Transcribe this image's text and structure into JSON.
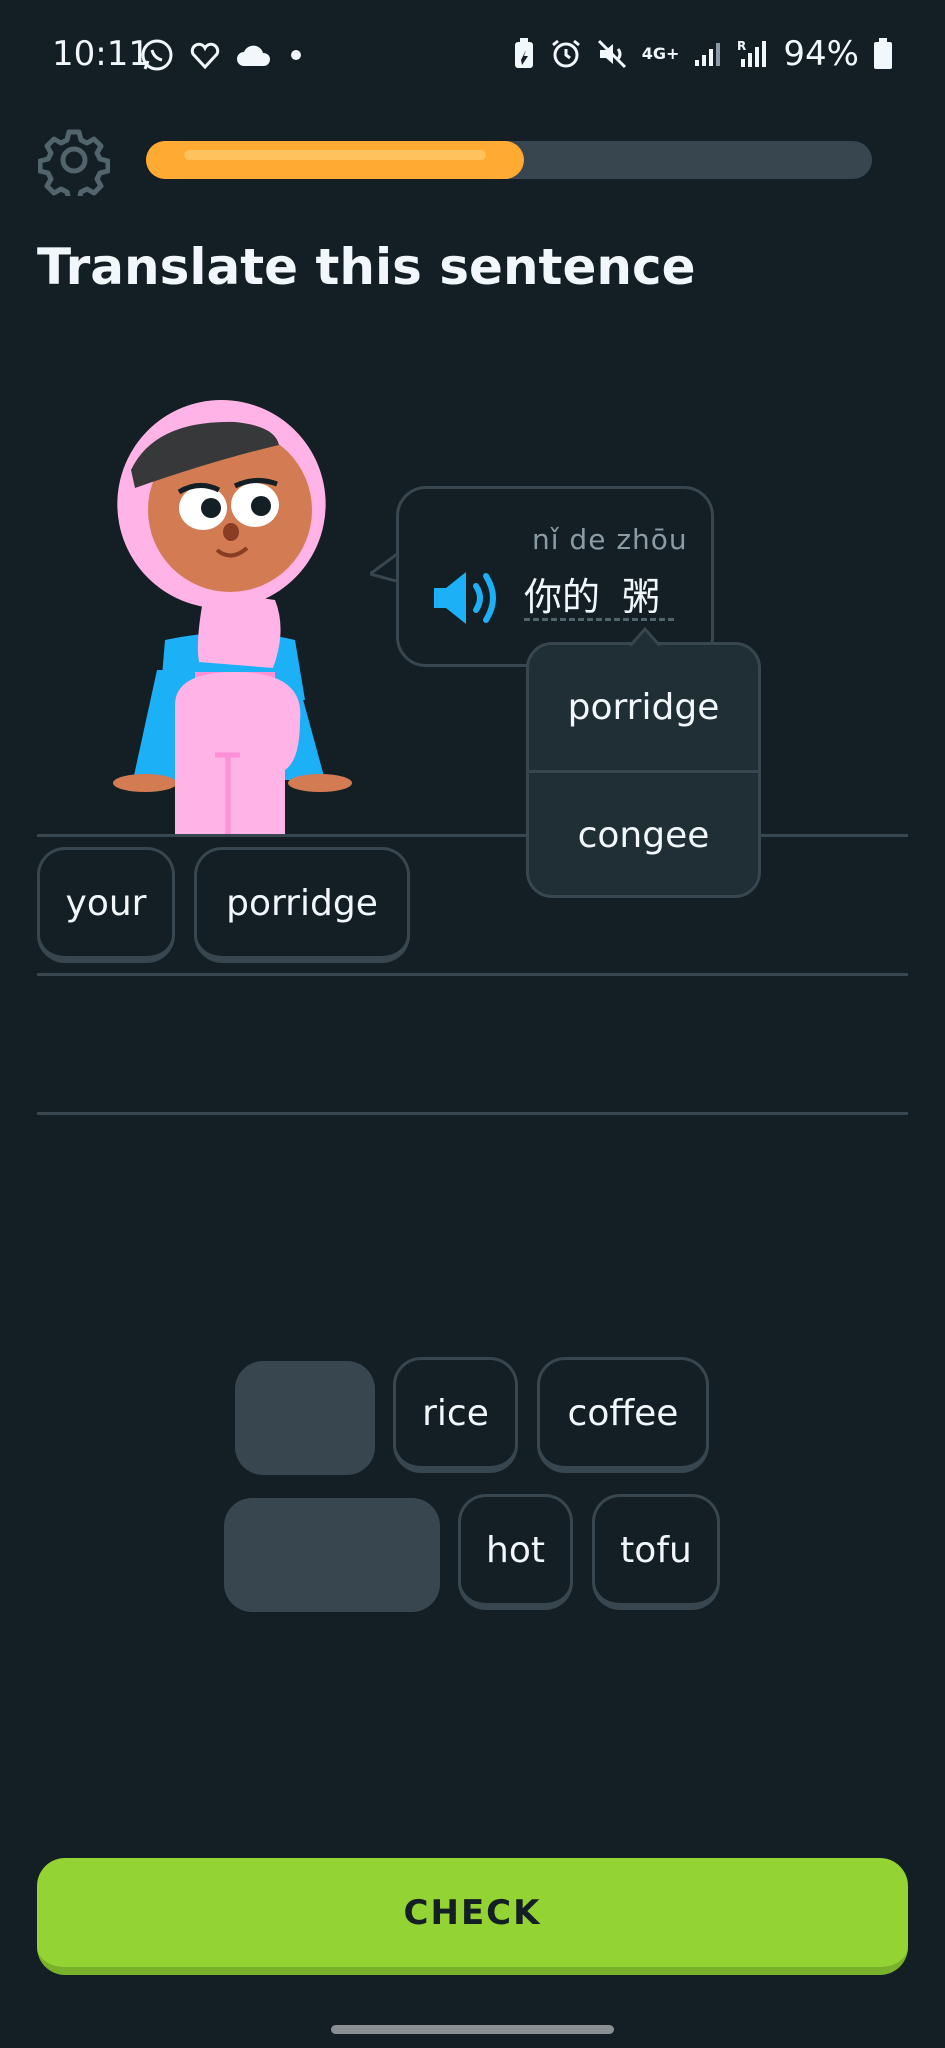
{
  "status_bar": {
    "time": "10:11",
    "battery_percent": "94%",
    "network_label": "4G+",
    "left_icons": [
      "whatsapp-icon",
      "heart-app-icon",
      "cloud-icon",
      "dot-icon"
    ],
    "right_icons": [
      "battery-saver-icon",
      "alarm-icon",
      "mute-icon",
      "network-4g-icon",
      "signal-icon",
      "roaming-signal-icon",
      "battery-icon"
    ]
  },
  "header": {
    "settings_icon": "gear-icon",
    "progress_fraction": 0.52
  },
  "prompt": {
    "title": "Translate this sentence"
  },
  "speech_bubble": {
    "pinyin": "nǐ de zhōu",
    "hanzi_1": "你的",
    "hanzi_2": "粥",
    "speaker_icon": "speaker-icon"
  },
  "hint_popup": {
    "options": [
      "porridge",
      "congee"
    ]
  },
  "answer": {
    "selected_tiles": [
      "your",
      "porridge"
    ]
  },
  "word_bank": {
    "row1": [
      "rice",
      "coffee"
    ],
    "row2": [
      "hot",
      "tofu"
    ]
  },
  "footer": {
    "check_label": "CHECK"
  },
  "colors": {
    "background": "#131f24",
    "accent_progress": "#ffab33",
    "check_green": "#93d333",
    "tile_border": "#37464f",
    "speaker_blue": "#1cb0f6"
  }
}
